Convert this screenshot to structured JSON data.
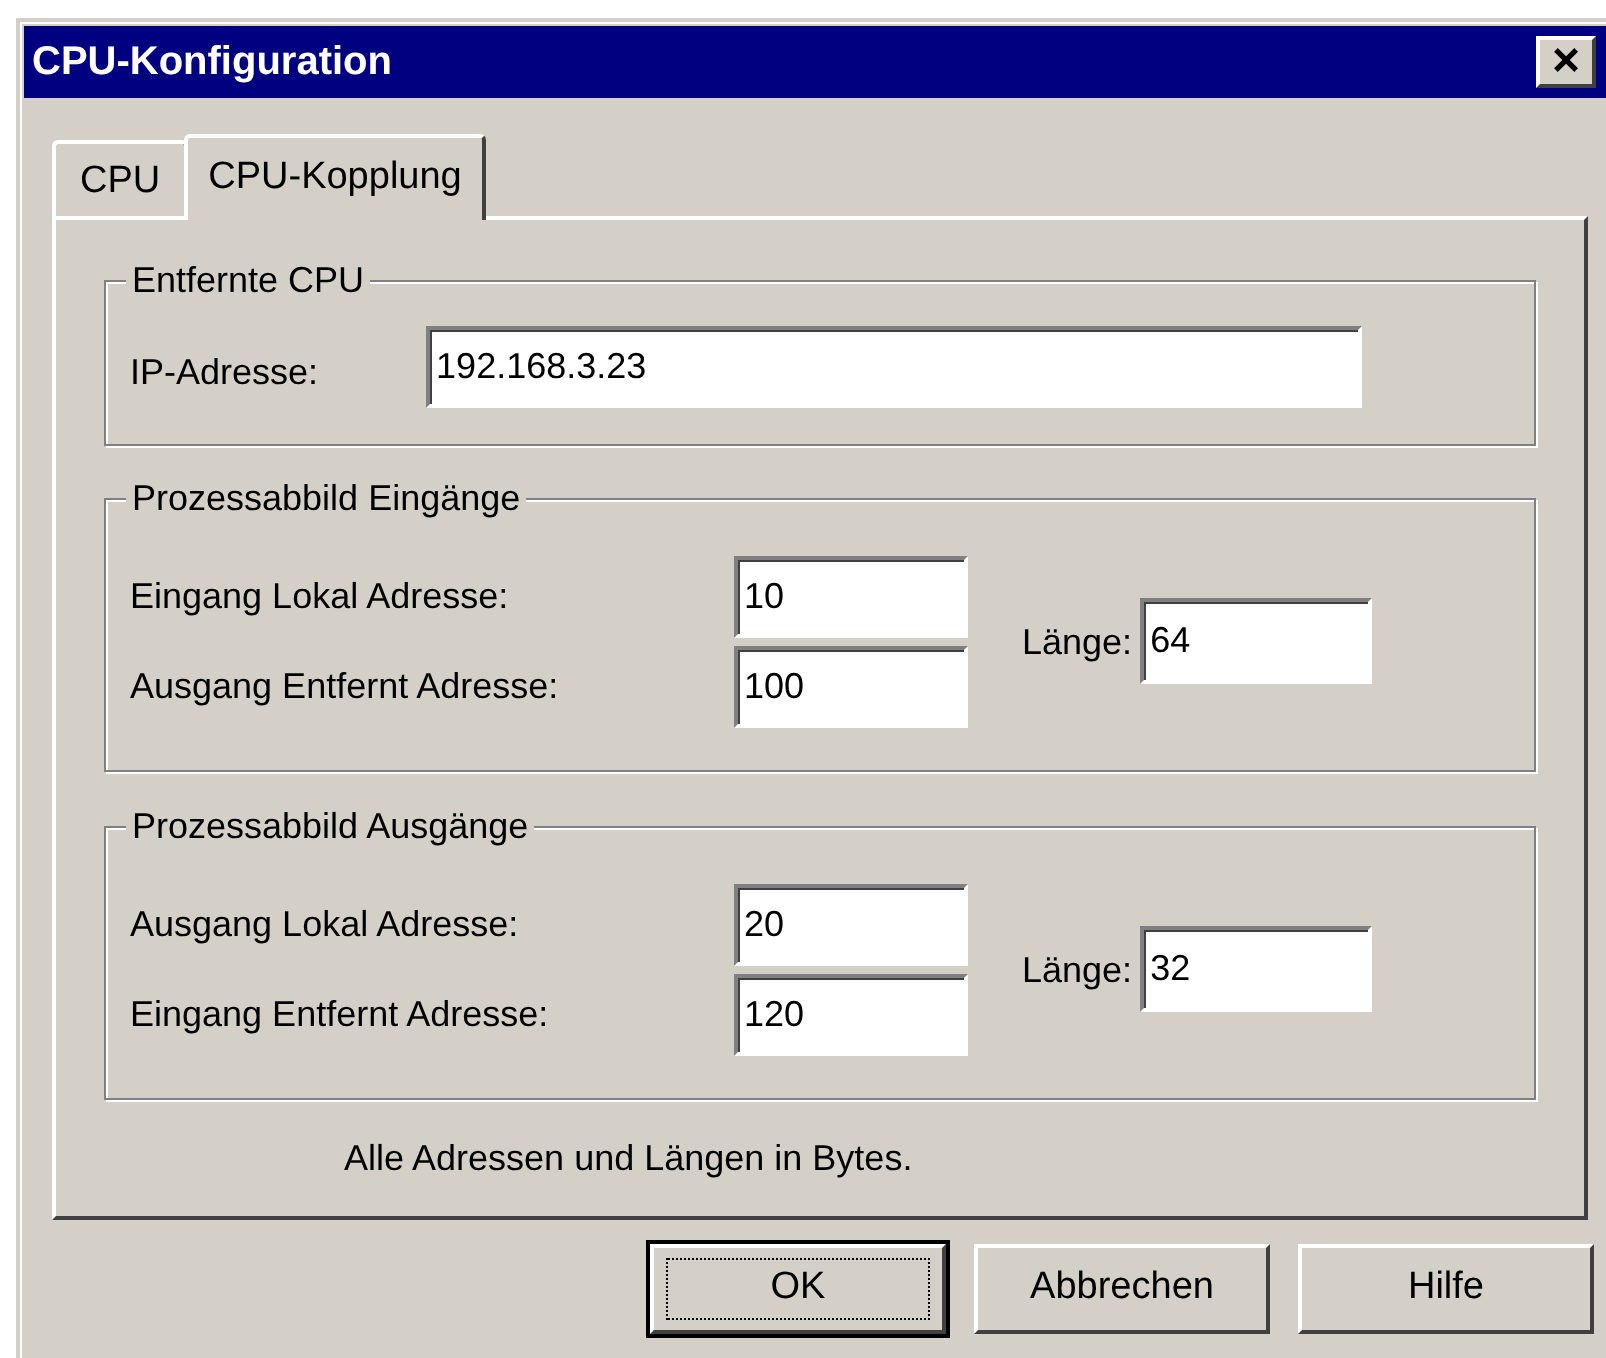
{
  "window": {
    "title": "CPU-Konfiguration",
    "close": "×"
  },
  "tabs": [
    {
      "label": "CPU",
      "selected": false
    },
    {
      "label": "CPU-Kopplung",
      "selected": true
    }
  ],
  "remote_cpu": {
    "title": "Entfernte CPU",
    "ip_label": "IP-Adresse:",
    "ip_value": "192.168.3.23"
  },
  "groups": [
    {
      "title": "Prozessabbild Eingänge",
      "rows": [
        {
          "label": "Eingang Lokal Adresse:",
          "value": "10"
        },
        {
          "label": "Ausgang Entfernt Adresse:",
          "value": "100"
        }
      ],
      "length_label": "Länge:",
      "length_value": "64"
    },
    {
      "title": "Prozessabbild Ausgänge",
      "rows": [
        {
          "label": "Ausgang Lokal Adresse:",
          "value": "20"
        },
        {
          "label": "Eingang Entfernt Adresse:",
          "value": "120"
        }
      ],
      "length_label": "Länge:",
      "length_value": "32"
    }
  ],
  "note": "Alle Adressen und Längen in Bytes.",
  "buttons": [
    {
      "label": "OK",
      "default": true
    },
    {
      "label": "Abbrechen",
      "default": false
    },
    {
      "label": "Hilfe",
      "default": false
    }
  ]
}
